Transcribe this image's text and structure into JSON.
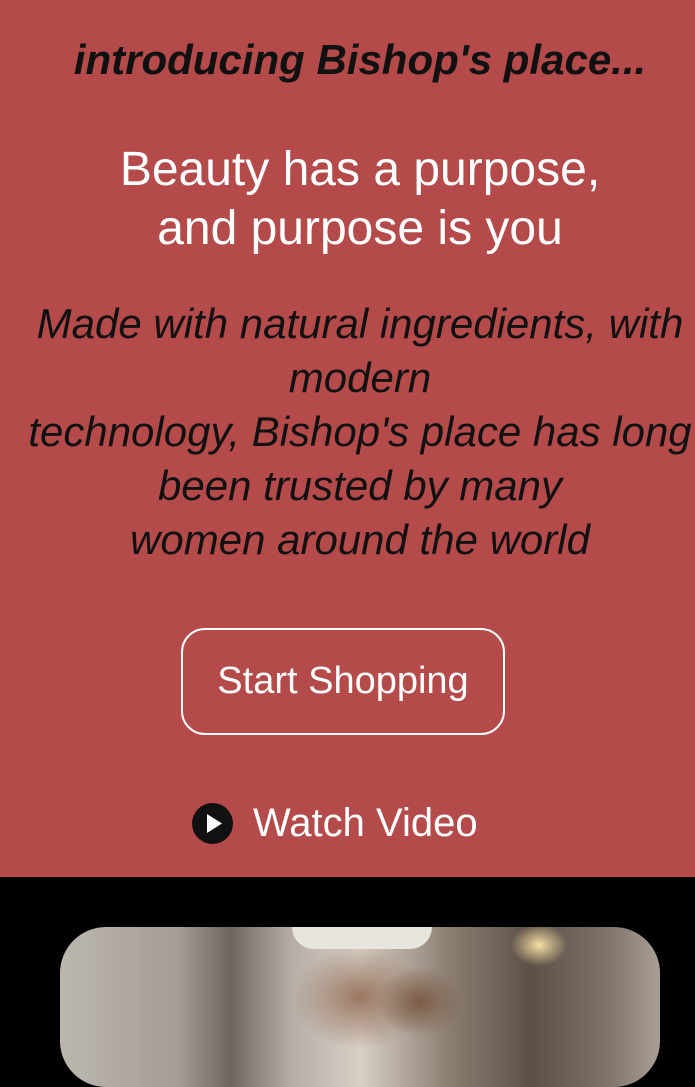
{
  "hero": {
    "intro": "introducing Bishop's place...",
    "headline_lines": [
      "Beauty has a purpose,",
      "and purpose is you"
    ],
    "description_lines": [
      "Made with natural ingredients, with",
      "modern",
      "technology, Bishop's place has long",
      "been trusted by many",
      "women around the world"
    ],
    "shop_button_label": "Start Shopping",
    "watch_video_label": "Watch Video",
    "play_icon": "play-circle-icon"
  },
  "colors": {
    "hero_background": "#b54a4a",
    "page_background": "#000000",
    "dark_text": "#111111",
    "light_text": "#ffffff"
  }
}
